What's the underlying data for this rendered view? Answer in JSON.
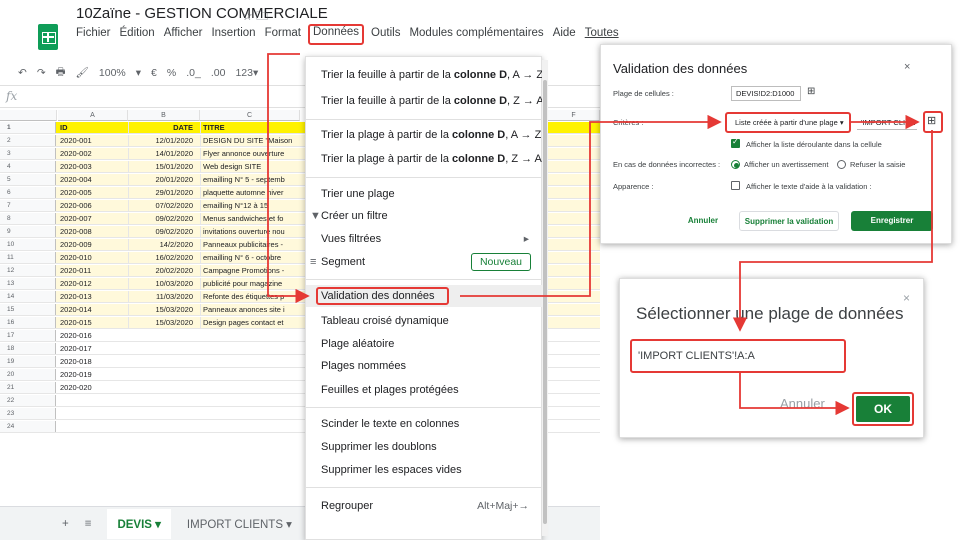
{
  "doc": {
    "title": "10Zaïne - GESTION COMMERCIALE",
    "menu": [
      "Fichier",
      "Édition",
      "Afficher",
      "Insertion",
      "Format",
      "Données",
      "Outils",
      "Modules complémentaires",
      "Aide",
      "Toutes"
    ]
  },
  "toolbar": {
    "zoom": "100%",
    "currency": "€",
    "percent": "%",
    "dec_less": ".0_",
    "dec_more": ".00",
    "format": "123▾"
  },
  "fx": "fx",
  "columns": [
    "A",
    "B",
    "C",
    "F"
  ],
  "sheet": {
    "header": {
      "id": "ID",
      "date": "DATE",
      "title": "TITRE"
    },
    "rows": [
      {
        "n": "2",
        "id": "2020-001",
        "date": "12/01/2020",
        "title": "DESIGN DU SITE \"Maison"
      },
      {
        "n": "3",
        "id": "2020-002",
        "date": "14/01/2020",
        "title": "Flyer annonce ouverture"
      },
      {
        "n": "4",
        "id": "2020-003",
        "date": "15/01/2020",
        "title": "Web design SITE"
      },
      {
        "n": "5",
        "id": "2020-004",
        "date": "20/01/2020",
        "title": "emailling N° 5 - septemb"
      },
      {
        "n": "6",
        "id": "2020-005",
        "date": "29/01/2020",
        "title": "plaquette automne hiver"
      },
      {
        "n": "7",
        "id": "2020-006",
        "date": "07/02/2020",
        "title": "emailling N°12 à 15"
      },
      {
        "n": "8",
        "id": "2020-007",
        "date": "09/02/2020",
        "title": "Menus sandwiches et fo"
      },
      {
        "n": "9",
        "id": "2020-008",
        "date": "09/02/2020",
        "title": "invitations ouverture nou"
      },
      {
        "n": "10",
        "id": "2020-009",
        "date": "14/2/2020",
        "title": "Panneaux publicitaires -"
      },
      {
        "n": "11",
        "id": "2020-010",
        "date": "16/02/2020",
        "title": "emailling N° 6 - octobre"
      },
      {
        "n": "12",
        "id": "2020-011",
        "date": "20/02/2020",
        "title": "Campagne Promotions -"
      },
      {
        "n": "13",
        "id": "2020-012",
        "date": "10/03/2020",
        "title": "publicité pour magazine"
      },
      {
        "n": "14",
        "id": "2020-013",
        "date": "11/03/2020",
        "title": "Refonte des étiquettes p"
      },
      {
        "n": "15",
        "id": "2020-014",
        "date": "15/03/2020",
        "title": "Panneaux anonces site i"
      },
      {
        "n": "16",
        "id": "2020-015",
        "date": "15/03/2020",
        "title": "Design pages contact et"
      },
      {
        "n": "17",
        "id": "2020-016",
        "date": "",
        "title": ""
      },
      {
        "n": "18",
        "id": "2020-017",
        "date": "",
        "title": ""
      },
      {
        "n": "19",
        "id": "2020-018",
        "date": "",
        "title": ""
      },
      {
        "n": "20",
        "id": "2020-019",
        "date": "",
        "title": ""
      },
      {
        "n": "21",
        "id": "2020-020",
        "date": "",
        "title": ""
      },
      {
        "n": "22",
        "id": "",
        "date": "",
        "title": ""
      },
      {
        "n": "23",
        "id": "",
        "date": "",
        "title": ""
      },
      {
        "n": "24",
        "id": "",
        "date": "",
        "title": ""
      }
    ]
  },
  "tabs": {
    "add": "+",
    "all": "≡",
    "active": "DEVIS ▾",
    "other": "IMPORT CLIENTS ▾"
  },
  "data_menu": {
    "sortD_az_pre": "Trier la feuille à partir de la ",
    "sortD_az_bold": "colonne D",
    "sortD_az_post": ", A → Z",
    "sortD_za_pre": "Trier la feuille à partir de la ",
    "sortD_za_bold": "colonne D",
    "sortD_za_post": ", Z → A",
    "rangeD_az_pre": "Trier la plage à partir de la ",
    "rangeD_az_bold": "colonne D",
    "rangeD_az_post": ", A → Z",
    "rangeD_za_pre": "Trier la plage à partir de la ",
    "rangeD_za_bold": "colonne D",
    "rangeD_za_post": ", Z → A",
    "sort_range": "Trier une plage",
    "filter": "Créer un filtre",
    "filter_views": "Vues filtrées",
    "slicer": "Segment",
    "slicer_badge": "Nouveau",
    "validation": "Validation des données",
    "pivot": "Tableau croisé dynamique",
    "random": "Plage aléatoire",
    "named": "Plages nommées",
    "protected": "Feuilles et plages protégées",
    "split": "Scinder le texte en colonnes",
    "dedupe": "Supprimer les doublons",
    "trim": "Supprimer les espaces vides",
    "group": "Regrouper",
    "group_shortcut": "Alt+Maj+→"
  },
  "validation_dialog": {
    "title": "Validation des données",
    "close": "×",
    "range_label": "Plage de cellules :",
    "range_value": "DEVIS!D2:D1000",
    "criteria_label": "Critères :",
    "criteria_value": "Liste créée à partir d'une plage ▾",
    "criteria_range": "'IMPORT CLIEN",
    "show_dropdown": "Afficher la liste déroulante dans la cellule",
    "invalid_label": "En cas de données incorrectes :",
    "warn": "Afficher un avertissement",
    "reject": "Refuser la saisie",
    "appearance_label": "Apparence :",
    "help_text": "Afficher le texte d'aide à la validation :",
    "cancel": "Annuler",
    "remove": "Supprimer la validation",
    "save": "Enregistrer"
  },
  "range_picker": {
    "title": "Sélectionner une plage de données",
    "close": "×",
    "value": "'IMPORT CLIENTS'!A:A",
    "cancel": "Annuler",
    "ok": "OK"
  },
  "colors": {
    "accent_green": "#188038",
    "highlight_red": "#e53935",
    "header_yellow": "#fff200",
    "row_yellow": "#fff9db"
  }
}
